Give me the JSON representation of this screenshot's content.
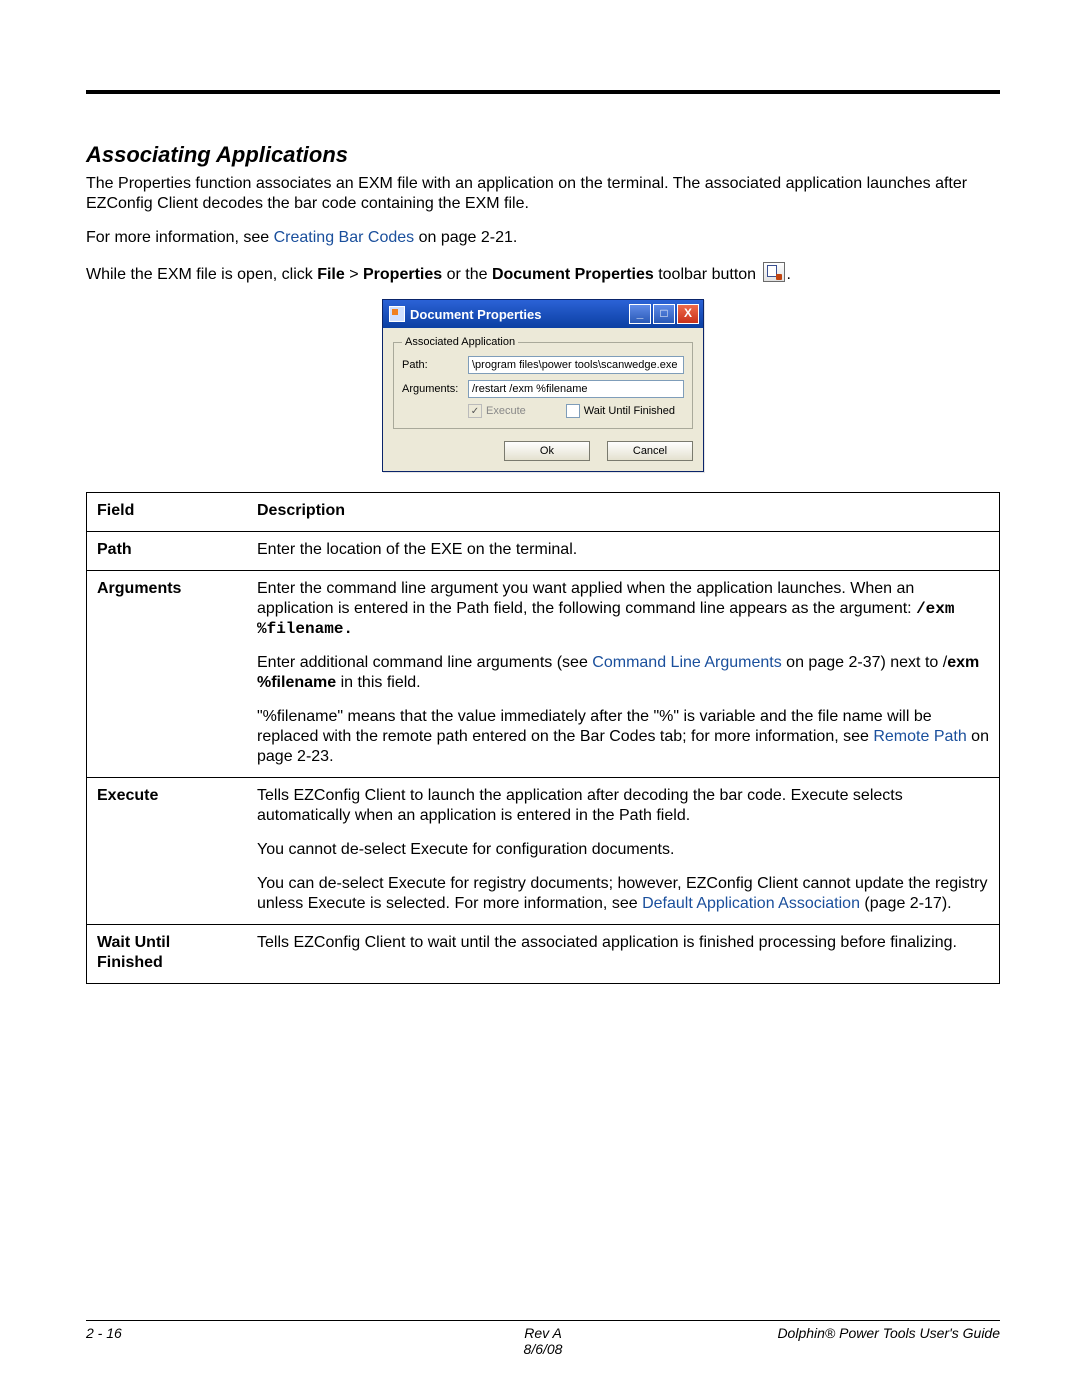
{
  "section_heading": "Associating Applications",
  "para1": "The Properties function associates an EXM file with an application on the terminal. The associated application launches after EZConfig Client decodes the bar code containing the EXM file.",
  "para2_pre": "For more information, see ",
  "para2_link": "Creating Bar Codes",
  "para2_post": " on page 2-21.",
  "para3_a": "While the EXM file is open, click ",
  "para3_b": "File",
  "para3_c": " > ",
  "para3_d": "Properties",
  "para3_e": " or the ",
  "para3_f": "Document Properties",
  "para3_g": " toolbar button ",
  "para3_end": ".",
  "dialog": {
    "title": "Document Properties",
    "group_legend": "Associated Application",
    "path_label": "Path:",
    "path_value": "\\program files\\power tools\\scanwedge.exe",
    "args_label": "Arguments:",
    "args_value": "/restart /exm %filename",
    "execute_label": "Execute",
    "wait_label": "Wait Until Finished",
    "ok": "Ok",
    "cancel": "Cancel",
    "min": "_",
    "max": "□",
    "close": "X"
  },
  "table": {
    "h1": "Field",
    "h2": "Description",
    "rows": {
      "path": {
        "field": "Path",
        "desc": "Enter the location of the EXE on the terminal."
      },
      "arguments": {
        "field": "Arguments",
        "p1": "Enter the command line argument you want applied when the application launches. When an application is entered in the Path field, the following command line appears as the argument: ",
        "p1_code": "/exm %filename.",
        "p2_a": "Enter additional command line arguments (see ",
        "p2_link": "Command Line Arguments",
        "p2_b": " on page 2-37) next to /",
        "p2_bold": "exm %filename",
        "p2_c": " in this field.",
        "p3_a": "\"%filename\" means that the value immediately after the \"%\" is variable and the file name will be replaced with the remote path entered on the Bar Codes tab; for more information, see ",
        "p3_link": "Remote Path",
        "p3_b": " on page 2-23."
      },
      "execute": {
        "field": "Execute",
        "p1": "Tells EZConfig Client to launch the application after decoding the bar code. Execute selects automatically when an application is entered in the Path field.",
        "p2": "You cannot de-select Execute for configuration documents.",
        "p3_a": "You can de-select Execute for registry documents; however, EZConfig Client cannot update the registry unless Execute is selected. For more information, see ",
        "p3_link": "Default Application Association",
        "p3_b": " (page 2-17)."
      },
      "wait": {
        "field": "Wait Until Finished",
        "desc": "Tells EZConfig Client to wait until the associated application is finished processing before finalizing."
      }
    }
  },
  "footer": {
    "page": "2 - 16",
    "rev": "Rev A",
    "date": "8/6/08",
    "guide": "Dolphin® Power Tools User's Guide"
  }
}
